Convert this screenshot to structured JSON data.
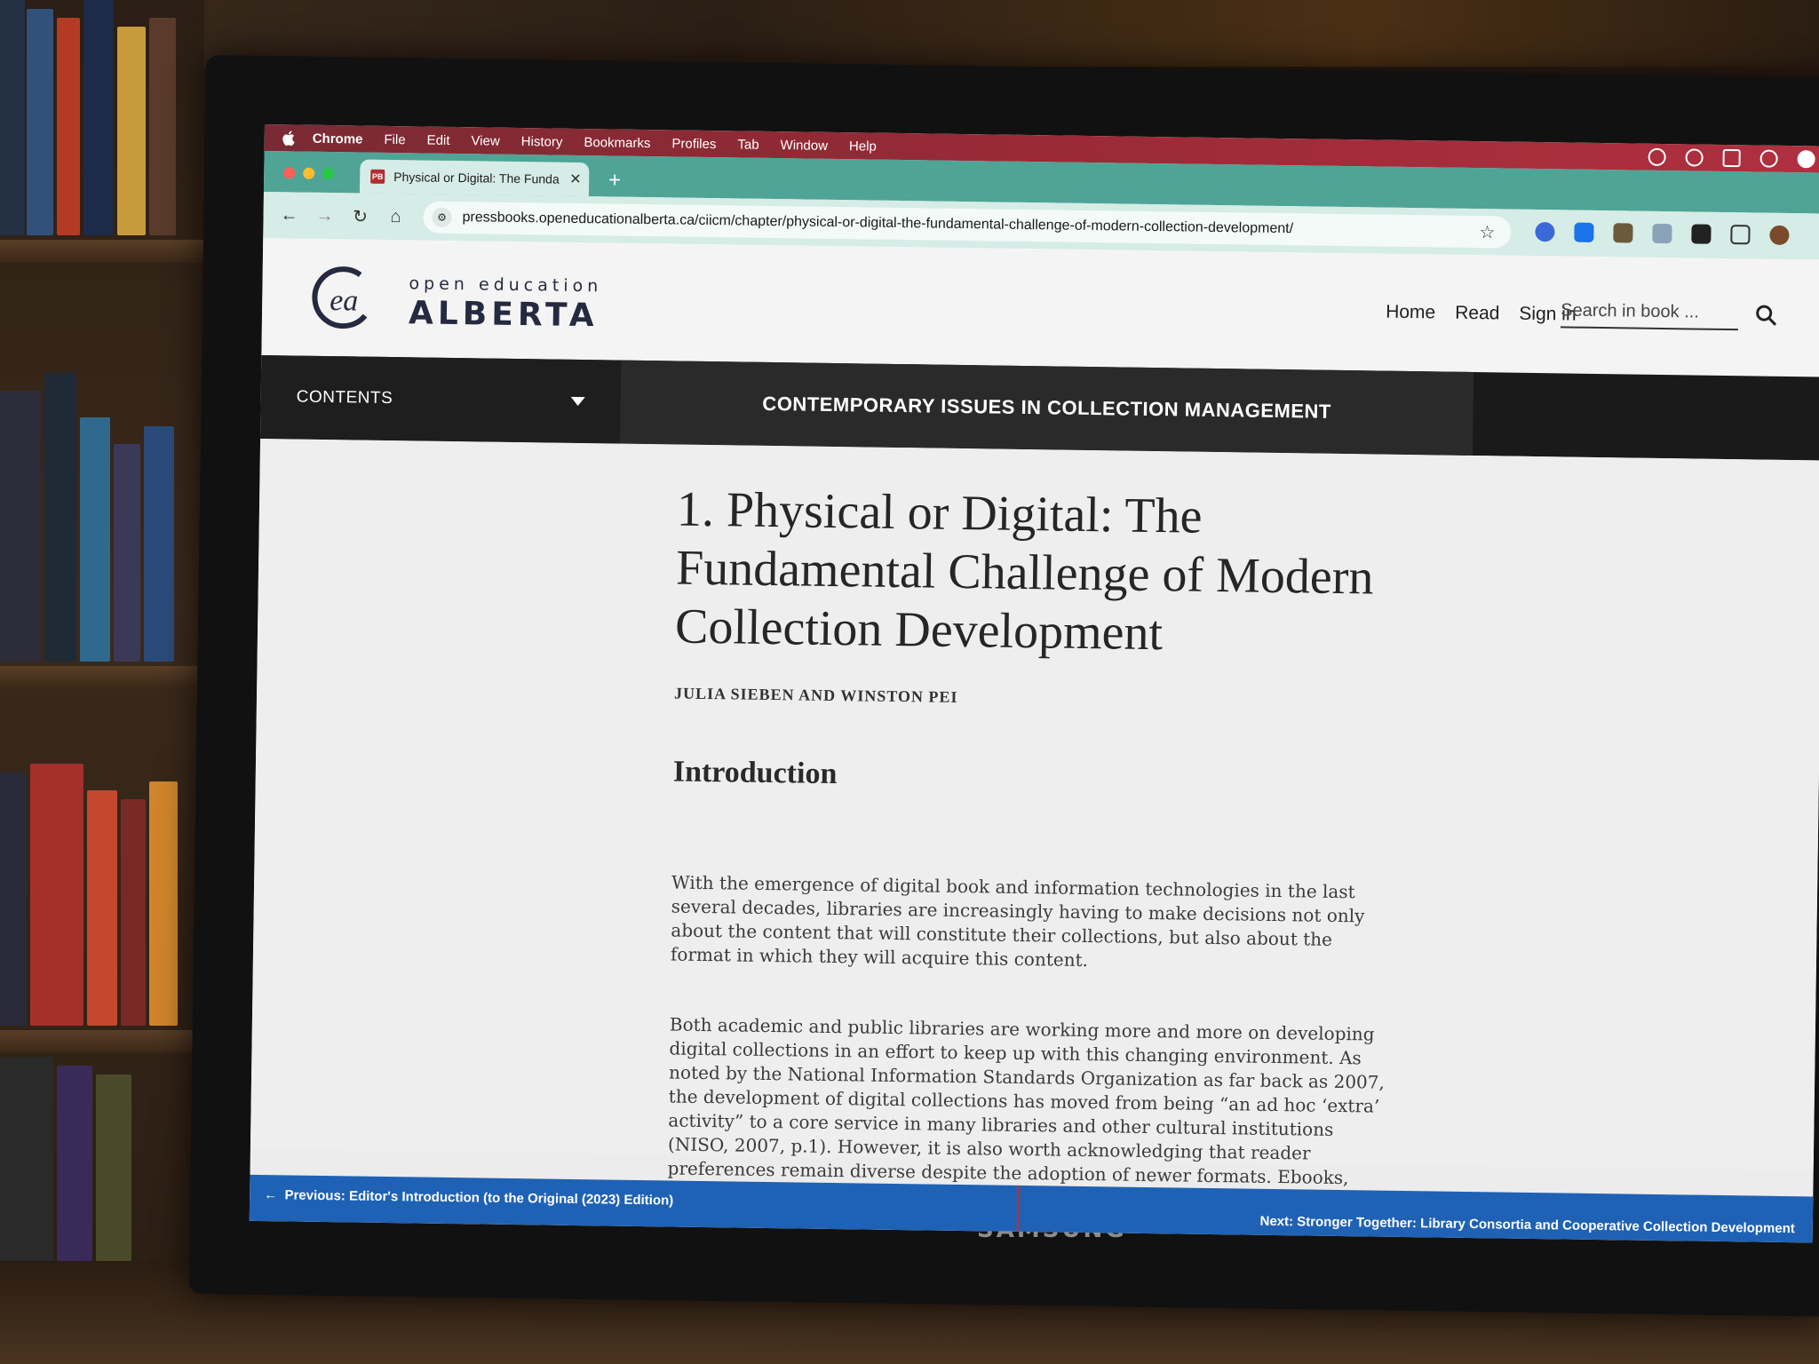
{
  "monitor_brand": "SAMSUNG",
  "menubar": {
    "app": "Chrome",
    "items": [
      "File",
      "Edit",
      "View",
      "History",
      "Bookmarks",
      "Profiles",
      "Tab",
      "Window",
      "Help"
    ]
  },
  "browser": {
    "tab_title": "Physical or Digital: The Funda",
    "favicon_text": "PB",
    "url": "pressbooks.openeducationalberta.ca/ciicm/chapter/physical-or-digital-the-fundamental-challenge-of-modern-collection-development/"
  },
  "site": {
    "logo_mark": "ea",
    "logo_small": "open education",
    "logo_big": "ALBERTA",
    "nav": [
      "Home",
      "Read",
      "Sign in"
    ],
    "search_placeholder": "Search in book ..."
  },
  "bookbar": {
    "contents_label": "CONTENTS",
    "book_title": "CONTEMPORARY ISSUES IN COLLECTION MANAGEMENT"
  },
  "article": {
    "chapter_title": "1. Physical or Digital: The Fundamental Challenge of Modern Collection Development",
    "authors": "JULIA SIEBEN AND WINSTON PEI",
    "heading": "Introduction",
    "paragraphs": [
      "With the emergence of digital book and information technologies in the last several decades, libraries are increasingly having to make decisions not only about the content that will constitute their collections, but also about the format in which they will acquire this content.",
      "Both academic and public libraries are working more and more on developing digital collections in an effort to keep up with this changing environment. As noted by the National Information Standards Organization as far back as 2007, the development of digital collections has moved from being “an ad hoc ‘extra’ activity” to a core service in many libraries and other cultural institutions (NISO, 2007, p.1). However, it is also worth acknowledging that reader preferences remain diverse despite the adoption of newer formats. Ebooks, print books, audiobooks,"
    ]
  },
  "bottom_nav": {
    "previous": "Previous: Editor's Introduction (to the Original (2023) Edition)",
    "next": "Next: Stronger Together: Library Consortia and Cooperative Collection Development"
  },
  "colors": {
    "menubar": "#9a2a36",
    "tabstrip": "#4fa496",
    "bottom_nav": "#1f62b5",
    "logo": "#262a40"
  }
}
